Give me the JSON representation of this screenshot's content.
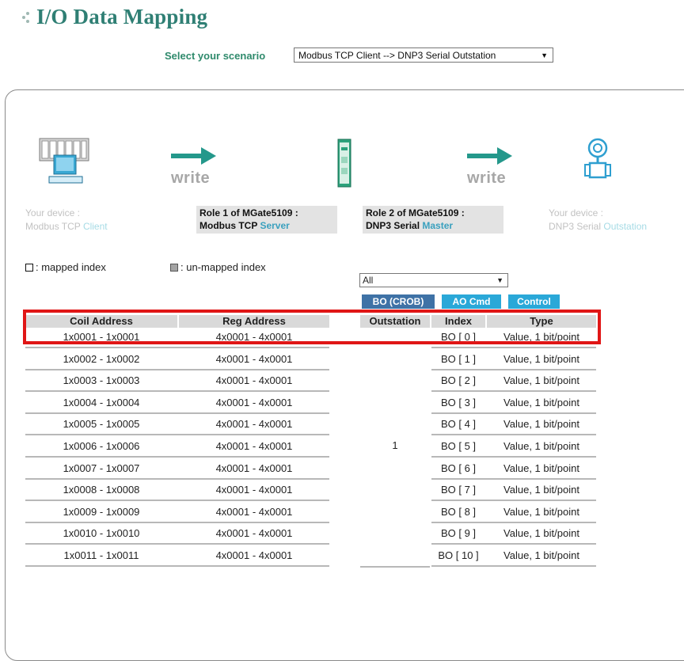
{
  "page": {
    "title": "I/O Data Mapping"
  },
  "scenario": {
    "label": "Select your scenario",
    "selected": "Modbus TCP Client --> DNP3 Serial Outstation"
  },
  "diagram": {
    "write_left": "write",
    "write_right": "write",
    "device_left": {
      "line1": "Your device :",
      "line2_prefix": "Modbus TCP ",
      "line2_accent": "Client"
    },
    "role1": {
      "line1": "Role 1 of MGate5109 :",
      "line2_prefix": "Modbus TCP ",
      "line2_accent": "Server"
    },
    "role2": {
      "line1": "Role 2 of MGate5109 :",
      "line2_prefix": "DNP3 Serial ",
      "line2_accent": "Master"
    },
    "device_right": {
      "line1": "Your device :",
      "line2_prefix": "DNP3 Serial ",
      "line2_accent": "Outstation"
    }
  },
  "legend": {
    "mapped": ": mapped index",
    "unmapped": ": un-mapped index"
  },
  "filter": {
    "selected": "All"
  },
  "buttons": {
    "bo_crob": "BO (CROB)",
    "ao_cmd": "AO Cmd",
    "control": "Control"
  },
  "table": {
    "headers": {
      "coil": "Coil Address",
      "reg": "Reg Address",
      "outstation": "Outstation",
      "index": "Index",
      "type": "Type"
    },
    "outstation_value": "1",
    "rows": [
      {
        "coil": "1x0001 - 1x0001",
        "reg": "4x0001 - 4x0001",
        "index": "BO [ 0 ]",
        "type": "Value, 1 bit/point"
      },
      {
        "coil": "1x0002 - 1x0002",
        "reg": "4x0001 - 4x0001",
        "index": "BO [ 1 ]",
        "type": "Value, 1 bit/point"
      },
      {
        "coil": "1x0003 - 1x0003",
        "reg": "4x0001 - 4x0001",
        "index": "BO [ 2 ]",
        "type": "Value, 1 bit/point"
      },
      {
        "coil": "1x0004 - 1x0004",
        "reg": "4x0001 - 4x0001",
        "index": "BO [ 3 ]",
        "type": "Value, 1 bit/point"
      },
      {
        "coil": "1x0005 - 1x0005",
        "reg": "4x0001 - 4x0001",
        "index": "BO [ 4 ]",
        "type": "Value, 1 bit/point"
      },
      {
        "coil": "1x0006 - 1x0006",
        "reg": "4x0001 - 4x0001",
        "index": "BO [ 5 ]",
        "type": "Value, 1 bit/point"
      },
      {
        "coil": "1x0007 - 1x0007",
        "reg": "4x0001 - 4x0001",
        "index": "BO [ 6 ]",
        "type": "Value, 1 bit/point"
      },
      {
        "coil": "1x0008 - 1x0008",
        "reg": "4x0001 - 4x0001",
        "index": "BO [ 7 ]",
        "type": "Value, 1 bit/point"
      },
      {
        "coil": "1x0009 - 1x0009",
        "reg": "4x0001 - 4x0001",
        "index": "BO [ 8 ]",
        "type": "Value, 1 bit/point"
      },
      {
        "coil": "1x0010 - 1x0010",
        "reg": "4x0001 - 4x0001",
        "index": "BO [ 9 ]",
        "type": "Value, 1 bit/point"
      },
      {
        "coil": "1x0011 - 1x0011",
        "reg": "4x0001 - 4x0001",
        "index": "BO [ 10 ]",
        "type": "Value, 1 bit/point"
      }
    ]
  },
  "colors": {
    "title": "#2f7f74",
    "accent": "#3aa0be",
    "highlight": "#e01616",
    "button_active": "#3f72a6",
    "button": "#2aa8d8"
  }
}
